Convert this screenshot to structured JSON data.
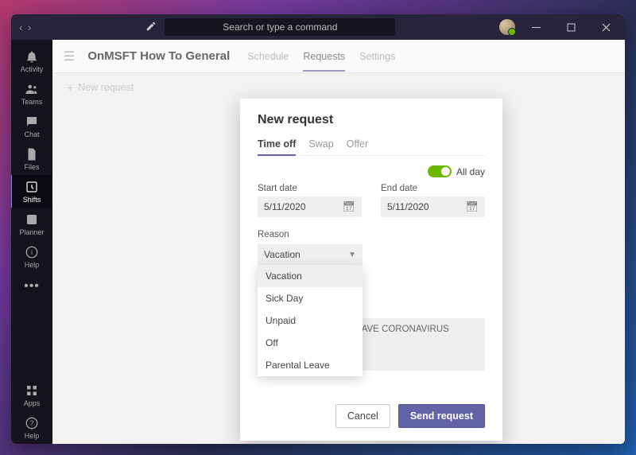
{
  "titlebar": {
    "search_placeholder": "Search or type a command"
  },
  "rail": {
    "items": [
      {
        "label": "Activity"
      },
      {
        "label": "Teams"
      },
      {
        "label": "Chat"
      },
      {
        "label": "Files"
      },
      {
        "label": "Shifts"
      },
      {
        "label": "Planner"
      },
      {
        "label": "Help"
      }
    ],
    "bottom": [
      {
        "label": "Apps"
      },
      {
        "label": "Help"
      }
    ]
  },
  "header": {
    "channel": "OnMSFT How To General",
    "tabs": [
      {
        "label": "Schedule"
      },
      {
        "label": "Requests"
      },
      {
        "label": "Settings"
      }
    ],
    "new_request": "New request"
  },
  "modal": {
    "title": "New request",
    "tabs": [
      {
        "label": "Time off"
      },
      {
        "label": "Swap"
      },
      {
        "label": "Offer"
      }
    ],
    "all_day_label": "All day",
    "start_date_label": "Start date",
    "start_date_value": "5/11/2020",
    "end_date_label": "End date",
    "end_date_value": "5/11/2020",
    "reason_label": "Reason",
    "reason_value": "Vacation",
    "reason_options": [
      "Vacation",
      "Sick Day",
      "Unpaid",
      "Off",
      "Parental Leave"
    ],
    "note_text": "I HAVE CORONAVIRUS",
    "cancel": "Cancel",
    "send": "Send request"
  }
}
